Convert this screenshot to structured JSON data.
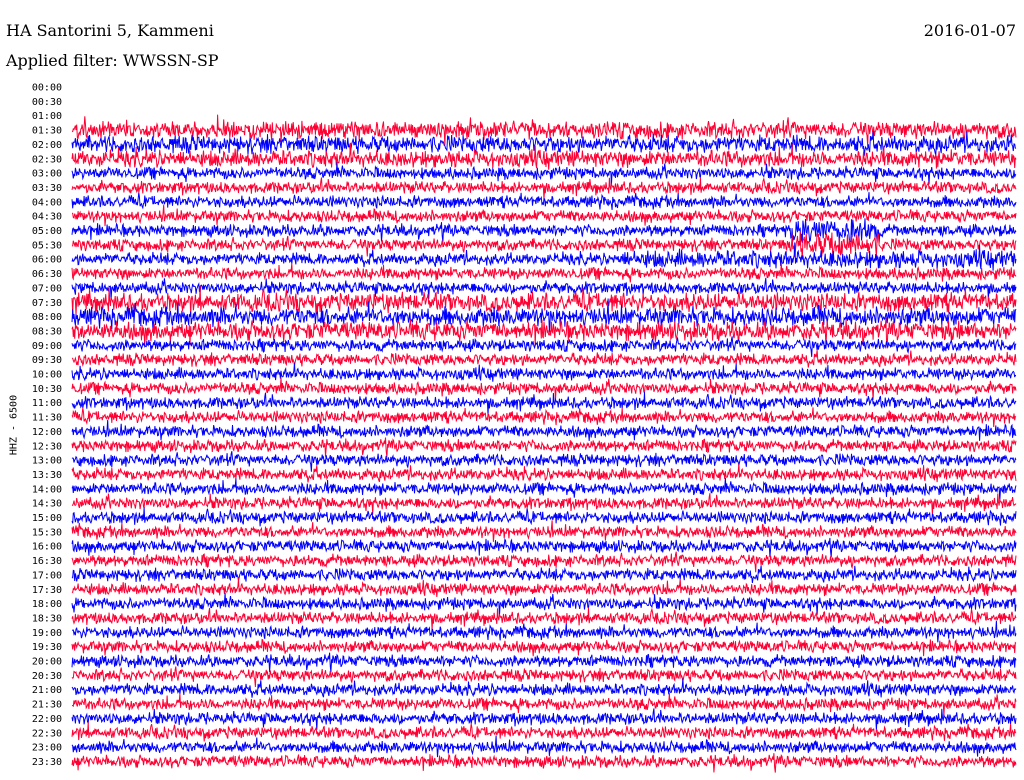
{
  "header": {
    "station": "HA Santorini 5, Kammeni",
    "date": "2016-01-07",
    "filter": "Applied filter: WWSSN-SP"
  },
  "channel_label": "HHZ - 6500",
  "colors": {
    "trace_a": "#0000ff",
    "trace_b": "#ff0033",
    "background": "#ffffff"
  },
  "chart_data": {
    "type": "line",
    "title": "HA Santorini 5, Kammeni",
    "subtitle": "Applied filter: WWSSN-SP",
    "ylabel": "HHZ - 6500",
    "xlabel": "",
    "tick_labels": [
      "00:00",
      "00:30",
      "01:00",
      "01:30",
      "02:00",
      "02:30",
      "03:00",
      "03:30",
      "04:00",
      "04:30",
      "05:00",
      "05:30",
      "06:00",
      "06:30",
      "07:00",
      "07:30",
      "08:00",
      "08:30",
      "09:00",
      "09:30",
      "10:00",
      "10:30",
      "11:00",
      "11:30",
      "12:00",
      "12:30",
      "13:00",
      "13:30",
      "14:00",
      "14:30",
      "15:00",
      "15:30",
      "16:00",
      "16:30",
      "17:00",
      "17:30",
      "18:00",
      "18:30",
      "19:00",
      "19:30",
      "20:00",
      "20:30",
      "21:00",
      "21:30",
      "22:00",
      "22:30",
      "23:00",
      "23:30"
    ],
    "series_colors": [
      "#0000ff",
      "#ff0033"
    ],
    "grid": false,
    "data_begins_at": "01:30"
  }
}
